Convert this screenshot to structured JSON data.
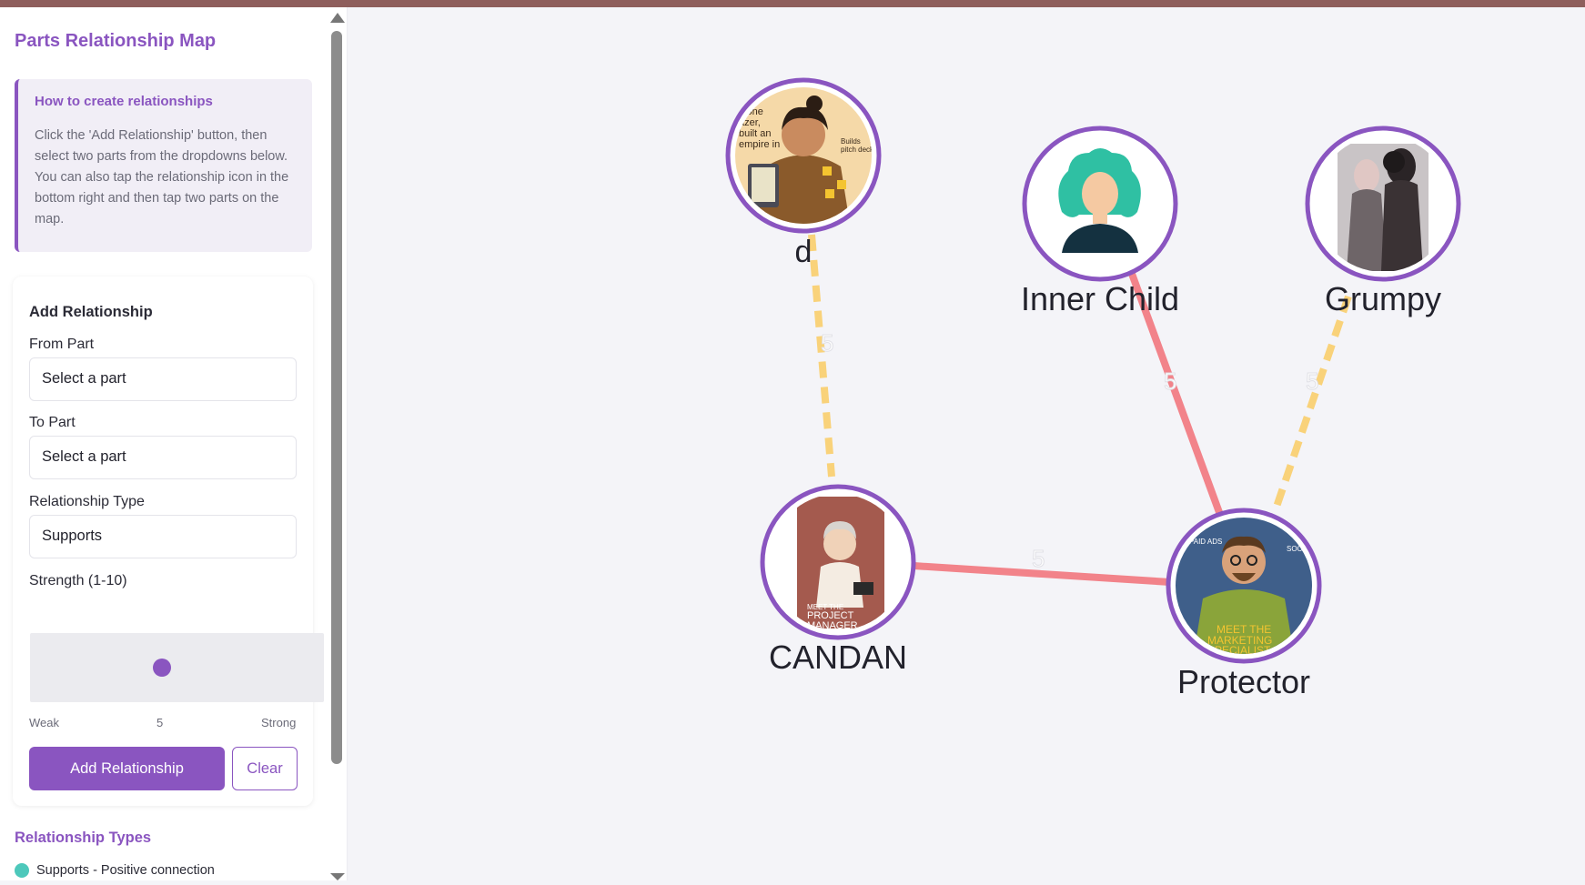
{
  "sidebar": {
    "title": "Parts Relationship Map",
    "howto": {
      "title": "How to create relationships",
      "text": "Click the 'Add Relationship' button, then select two parts from the dropdowns below. You can also tap the relationship icon in the bottom right and then tap two parts on the map."
    },
    "form": {
      "title": "Add Relationship",
      "from_label": "From Part",
      "from_value": "Select a part",
      "to_label": "To Part",
      "to_value": "Select a part",
      "type_label": "Relationship Type",
      "type_value": "Supports",
      "strength_label": "Strength (1-10)",
      "strength_value": 5,
      "strength_value_text": "5",
      "scale_min": "Weak",
      "scale_max": "Strong",
      "add_button": "Add Relationship",
      "clear_button": "Clear"
    },
    "types": {
      "title": "Relationship Types",
      "items": [
        {
          "label": "Supports - Positive connection",
          "color": "#4dc8bb"
        }
      ]
    }
  },
  "map": {
    "nodes": [
      {
        "id": "d",
        "label": "d",
        "avatar": "illustrated-woman-tablet"
      },
      {
        "id": "inner_child",
        "label": "Inner Child",
        "avatar": "placeholder-teal-hair-icon"
      },
      {
        "id": "grumpy",
        "label": "Grumpy",
        "avatar": "photo-two-people-fur"
      },
      {
        "id": "candan",
        "label": "CANDAN",
        "avatar": "illustrated-project-manager"
      },
      {
        "id": "protector",
        "label": "Protector",
        "avatar": "illustrated-marketing-specialist"
      }
    ],
    "edges": [
      {
        "from": "d",
        "to": "candan",
        "strength": "5",
        "style": "dashed",
        "color": "#f9d27a"
      },
      {
        "from": "inner_child",
        "to": "protector",
        "strength": "5",
        "style": "solid",
        "color": "#f2838a"
      },
      {
        "from": "grumpy",
        "to": "protector",
        "strength": "5",
        "style": "dashed",
        "color": "#f9d27a"
      },
      {
        "from": "candan",
        "to": "protector",
        "strength": "5",
        "style": "solid",
        "color": "#f2838a"
      }
    ],
    "node_border_color": "#8a55c0"
  }
}
